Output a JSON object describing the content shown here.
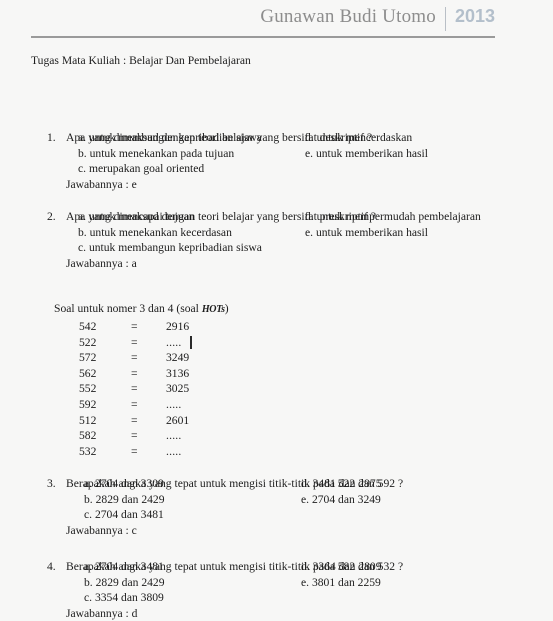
{
  "header": {
    "title": "Gunawan Budi Utomo",
    "year": "2013"
  },
  "document": {
    "subject_line": "Tugas Mata Kuliah  : Belajar  Dan Pembelajaran",
    "answer_prefix": "Jawabannya : ",
    "soal_heading_prefix": "Soal untuk nomer 3 dan 4 (soal ",
    "soal_heading_hots": "HOTs",
    "soal_heading_suffix": ")",
    "questions": [
      {
        "number": "1.",
        "text": "Apa yang dimaksud dengan teori belajar yang bersifat deskriptif ?",
        "options_left": [
          "a.  untuk membangun kepribadian siswa",
          "b.  untuk menekankan pada tujuan",
          "c.  merupakan goal oriented"
        ],
        "options_right": [
          "d. untuk mencerdaskan",
          "e. untuk memberikan  hasil"
        ],
        "answer": "Jawabannya : e"
      },
      {
        "number": "2.",
        "text": "Apa yang dimaksud dengan teori belajar yang bersifat preskriptif ?",
        "options_left": [
          "a.  untuk mencapai tujuan",
          "b.  untuk menekankan kecerdasan",
          "c.  untuk membangun kepribadian  siswa"
        ],
        "options_right": [
          "d. untuk mempermudah pembelajaran",
          "e. untuk memberikan  hasil"
        ],
        "answer": "Jawabannya : a"
      },
      {
        "number": "3.",
        "text": "Berapakah angka yang tepat untuk mengisi titik-titik  pada 522 dan 592 ?",
        "options_left": [
          "a.   2704 dan 3309",
          "b.   2829 dan 2429",
          "c.   2704 dan 3481"
        ],
        "options_right": [
          "d. 3481 dan 2975",
          "e. 2704 dan 3249"
        ],
        "answer": "Jawabannya : c"
      },
      {
        "number": "4.",
        "text": "Berapakah angka yang tepat untuk mengisi titik-titik  pada 582 dan 532 ?",
        "options_left": [
          "a.   2704 dan 3481",
          "b.   2829 dan 2429",
          "c.   3354 dan 3809"
        ],
        "options_right": [
          "d. 3364 dan 2809",
          "e. 3801 dan 2259"
        ],
        "answer": "Jawabannya : d"
      }
    ],
    "number_table": [
      {
        "left": "542",
        "eq": "=",
        "right": "2916"
      },
      {
        "left": "522",
        "eq": "=",
        "right": "....."
      },
      {
        "left": "572",
        "eq": "=",
        "right": "3249"
      },
      {
        "left": "562",
        "eq": "=",
        "right": "3136"
      },
      {
        "left": "552",
        "eq": "=",
        "right": "3025"
      },
      {
        "left": "592",
        "eq": "=",
        "right": "....."
      },
      {
        "left": "512",
        "eq": "=",
        "right": "2601"
      },
      {
        "left": "582",
        "eq": "=",
        "right": "....."
      },
      {
        "left": "532",
        "eq": "=",
        "right": "....."
      }
    ]
  },
  "colors": {
    "page_background": "#f7f7f6",
    "title_gray": "#8d8d8d",
    "year_blue_gray": "#b3bfcb",
    "rule_gray": "#9a9a9a",
    "body_text": "#1d1d1d"
  }
}
